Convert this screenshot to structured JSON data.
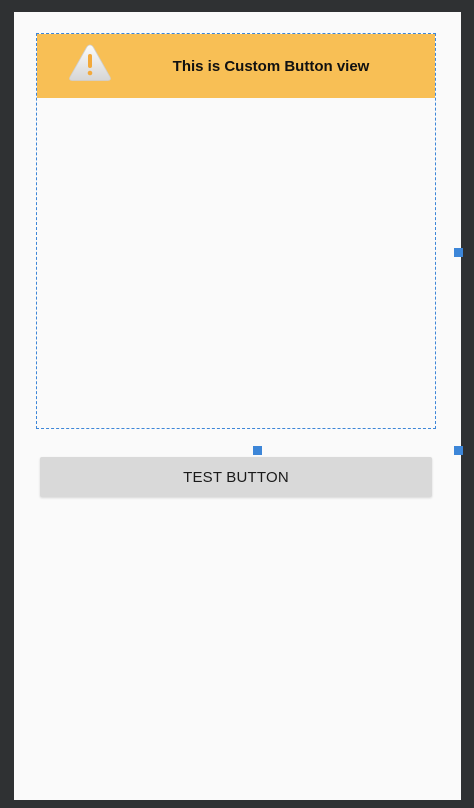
{
  "custom_view": {
    "banner_title": "This is Custom Button view",
    "banner_color": "#f8bf55",
    "icon": "warning-icon",
    "selection_color": "#3d86d8"
  },
  "test_button": {
    "label": "TEST BUTTON"
  }
}
